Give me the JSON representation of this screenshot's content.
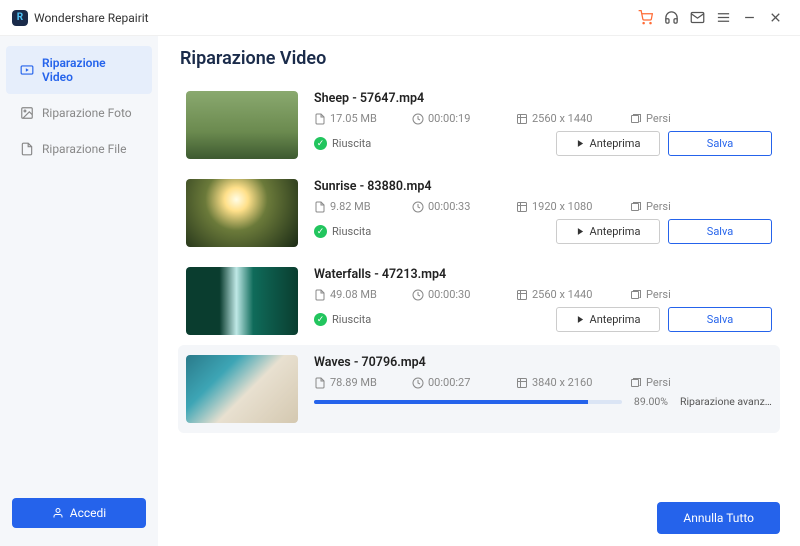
{
  "titlebar": {
    "app_name": "Wondershare Repairit"
  },
  "sidebar": {
    "items": [
      {
        "label": "Riparazione Video"
      },
      {
        "label": "Riparazione Foto"
      },
      {
        "label": "Riparazione File"
      }
    ],
    "login_label": "Accedi"
  },
  "page": {
    "title": "Riparazione Video"
  },
  "labels": {
    "preview": "Anteprima",
    "save": "Salva",
    "persi": "Persi",
    "success": "Riuscita"
  },
  "files": [
    {
      "name": "Sheep - 57647.mp4",
      "size": "17.05  MB",
      "duration": "00:00:19",
      "resolution": "2560 x 1440"
    },
    {
      "name": "Sunrise - 83880.mp4",
      "size": "9.82  MB",
      "duration": "00:00:33",
      "resolution": "1920 x 1080"
    },
    {
      "name": "Waterfalls - 47213.mp4",
      "size": "49.08  MB",
      "duration": "00:00:30",
      "resolution": "2560 x 1440"
    },
    {
      "name": "Waves - 70796.mp4",
      "size": "78.89  MB",
      "duration": "00:00:27",
      "resolution": "3840 x 2160"
    }
  ],
  "progress": {
    "percent": "89.00%",
    "label": "Riparazione avanzat..."
  },
  "footer": {
    "cancel_all": "Annulla Tutto"
  }
}
